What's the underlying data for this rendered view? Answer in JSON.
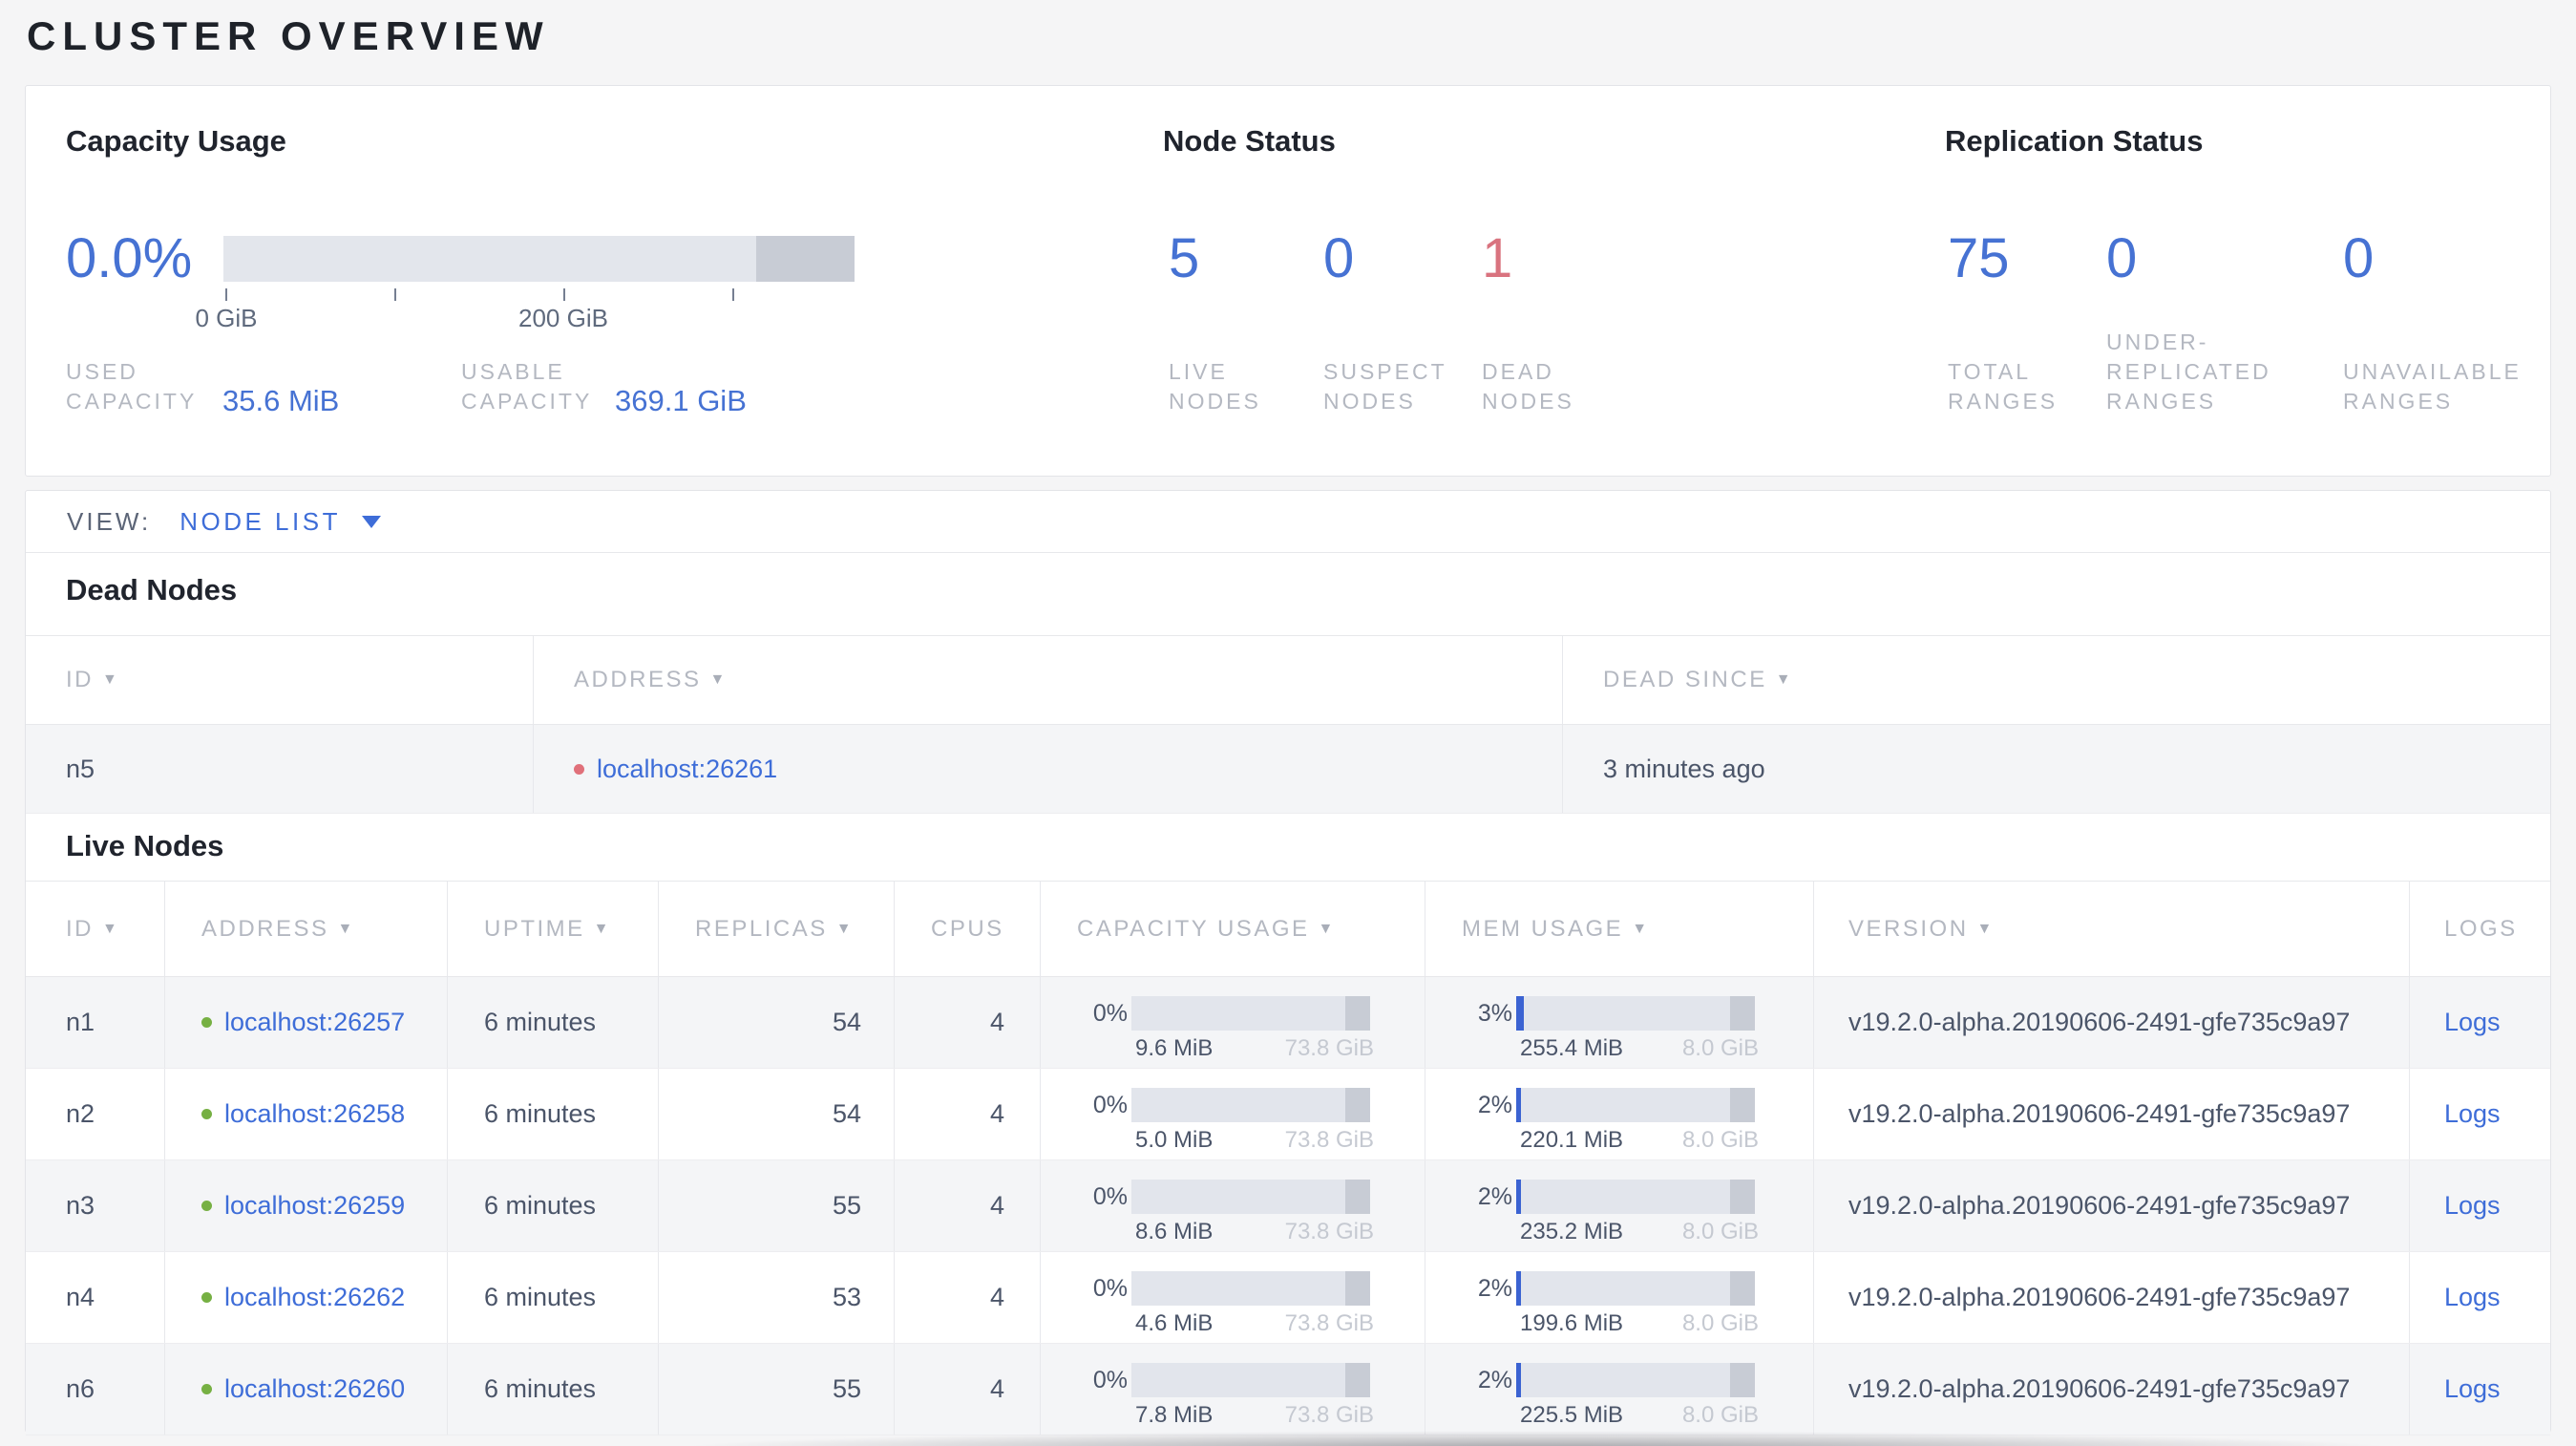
{
  "page_title": "CLUSTER OVERVIEW",
  "icons": {
    "sort_desc": "▼"
  },
  "colors": {
    "accent_blue": "#4672d3",
    "link_blue": "#3e6dd8",
    "danger_red": "#d9737f",
    "live_green": "#76b043",
    "dead_dot_red": "#e0707a",
    "label_gray": "#b4b8c1",
    "heading_dark": "#20242d",
    "body_slate": "#4b5569"
  },
  "summary": {
    "capacity": {
      "title": "Capacity Usage",
      "percent": "0.0%",
      "gauge_used_percent": "0%",
      "axis_labels": {
        "start": "0 GiB",
        "mid": "200 GiB"
      },
      "stats": [
        {
          "label_lines": [
            "USED",
            "CAPACITY"
          ],
          "value": "35.6 MiB"
        },
        {
          "label_lines": [
            "USABLE",
            "CAPACITY"
          ],
          "value": "369.1 GiB"
        }
      ]
    },
    "node_status": {
      "title": "Node Status",
      "stats": [
        {
          "value": "5",
          "label_lines": [
            "LIVE",
            "NODES"
          ],
          "tone": "blue"
        },
        {
          "value": "0",
          "label_lines": [
            "SUSPECT",
            "NODES"
          ],
          "tone": "blue"
        },
        {
          "value": "1",
          "label_lines": [
            "DEAD",
            "NODES"
          ],
          "tone": "red"
        }
      ]
    },
    "replication": {
      "title": "Replication Status",
      "stats": [
        {
          "value": "75",
          "label_lines": [
            "TOTAL",
            "RANGES"
          ],
          "tone": "blue"
        },
        {
          "value": "0",
          "label_lines": [
            "UNDER-",
            "REPLICATED",
            "RANGES"
          ],
          "tone": "blue"
        },
        {
          "value": "0",
          "label_lines": [
            "UNAVAILABLE",
            "RANGES"
          ],
          "tone": "blue"
        }
      ]
    }
  },
  "view_bar": {
    "label": "VIEW:",
    "selected": "NODE LIST"
  },
  "dead_nodes": {
    "title": "Dead Nodes",
    "columns": [
      {
        "label": "ID"
      },
      {
        "label": "ADDRESS"
      },
      {
        "label": "DEAD SINCE"
      }
    ],
    "rows": [
      {
        "id": "n5",
        "address": "localhost:26261",
        "dead_since": "3 minutes ago"
      }
    ]
  },
  "live_nodes": {
    "title": "Live Nodes",
    "columns": [
      {
        "label": "ID"
      },
      {
        "label": "ADDRESS"
      },
      {
        "label": "UPTIME"
      },
      {
        "label": "REPLICAS"
      },
      {
        "label": "CPUS"
      },
      {
        "label": "CAPACITY USAGE"
      },
      {
        "label": "MEM USAGE"
      },
      {
        "label": "VERSION"
      },
      {
        "label": "LOGS"
      }
    ],
    "rows": [
      {
        "id": "n1",
        "address": "localhost:26257",
        "uptime": "6 minutes",
        "replicas": "54",
        "cpus": "4",
        "capacity_percent": "0%",
        "capacity_used": "9.6 MiB",
        "capacity_total": "73.8 GiB",
        "mem_percent": "3%",
        "mem_used": "255.4 MiB",
        "mem_total": "8.0 GiB",
        "version": "v19.2.0-alpha.20190606-2491-gfe735c9a97",
        "logs": "Logs"
      },
      {
        "id": "n2",
        "address": "localhost:26258",
        "uptime": "6 minutes",
        "replicas": "54",
        "cpus": "4",
        "capacity_percent": "0%",
        "capacity_used": "5.0 MiB",
        "capacity_total": "73.8 GiB",
        "mem_percent": "2%",
        "mem_used": "220.1 MiB",
        "mem_total": "8.0 GiB",
        "version": "v19.2.0-alpha.20190606-2491-gfe735c9a97",
        "logs": "Logs"
      },
      {
        "id": "n3",
        "address": "localhost:26259",
        "uptime": "6 minutes",
        "replicas": "55",
        "cpus": "4",
        "capacity_percent": "0%",
        "capacity_used": "8.6 MiB",
        "capacity_total": "73.8 GiB",
        "mem_percent": "2%",
        "mem_used": "235.2 MiB",
        "mem_total": "8.0 GiB",
        "version": "v19.2.0-alpha.20190606-2491-gfe735c9a97",
        "logs": "Logs"
      },
      {
        "id": "n4",
        "address": "localhost:26262",
        "uptime": "6 minutes",
        "replicas": "53",
        "cpus": "4",
        "capacity_percent": "0%",
        "capacity_used": "4.6 MiB",
        "capacity_total": "73.8 GiB",
        "mem_percent": "2%",
        "mem_used": "199.6 MiB",
        "mem_total": "8.0 GiB",
        "version": "v19.2.0-alpha.20190606-2491-gfe735c9a97",
        "logs": "Logs"
      },
      {
        "id": "n6",
        "address": "localhost:26260",
        "uptime": "6 minutes",
        "replicas": "55",
        "cpus": "4",
        "capacity_percent": "0%",
        "capacity_used": "7.8 MiB",
        "capacity_total": "73.8 GiB",
        "mem_percent": "2%",
        "mem_used": "225.5 MiB",
        "mem_total": "8.0 GiB",
        "version": "v19.2.0-alpha.20190606-2491-gfe735c9a97",
        "logs": "Logs"
      }
    ]
  }
}
